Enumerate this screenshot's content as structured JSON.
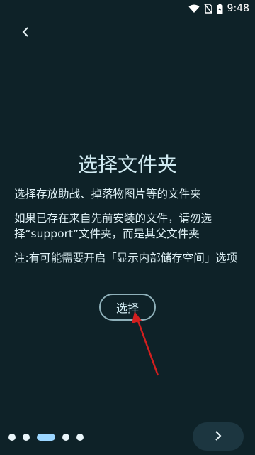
{
  "status": {
    "time": "9:48",
    "icons": [
      "wifi-icon",
      "no-sim-icon",
      "battery-charging-icon"
    ]
  },
  "page": {
    "title": "选择文件夹",
    "description": "选择存放助战、掉落物图片等的文件夹",
    "previous_install_note": "如果已存在来自先前安装的文件，请勿选择“support”文件夹，而是其父文件夹",
    "notice": "注:有可能需要开启「显示内部储存空间」选项"
  },
  "actions": {
    "select_label": "选择"
  },
  "pager": {
    "total": 5,
    "active_index": 2
  },
  "colors": {
    "background": "#0e2228",
    "accent": "#9bd6ff",
    "arrow": "#d21f1f"
  }
}
